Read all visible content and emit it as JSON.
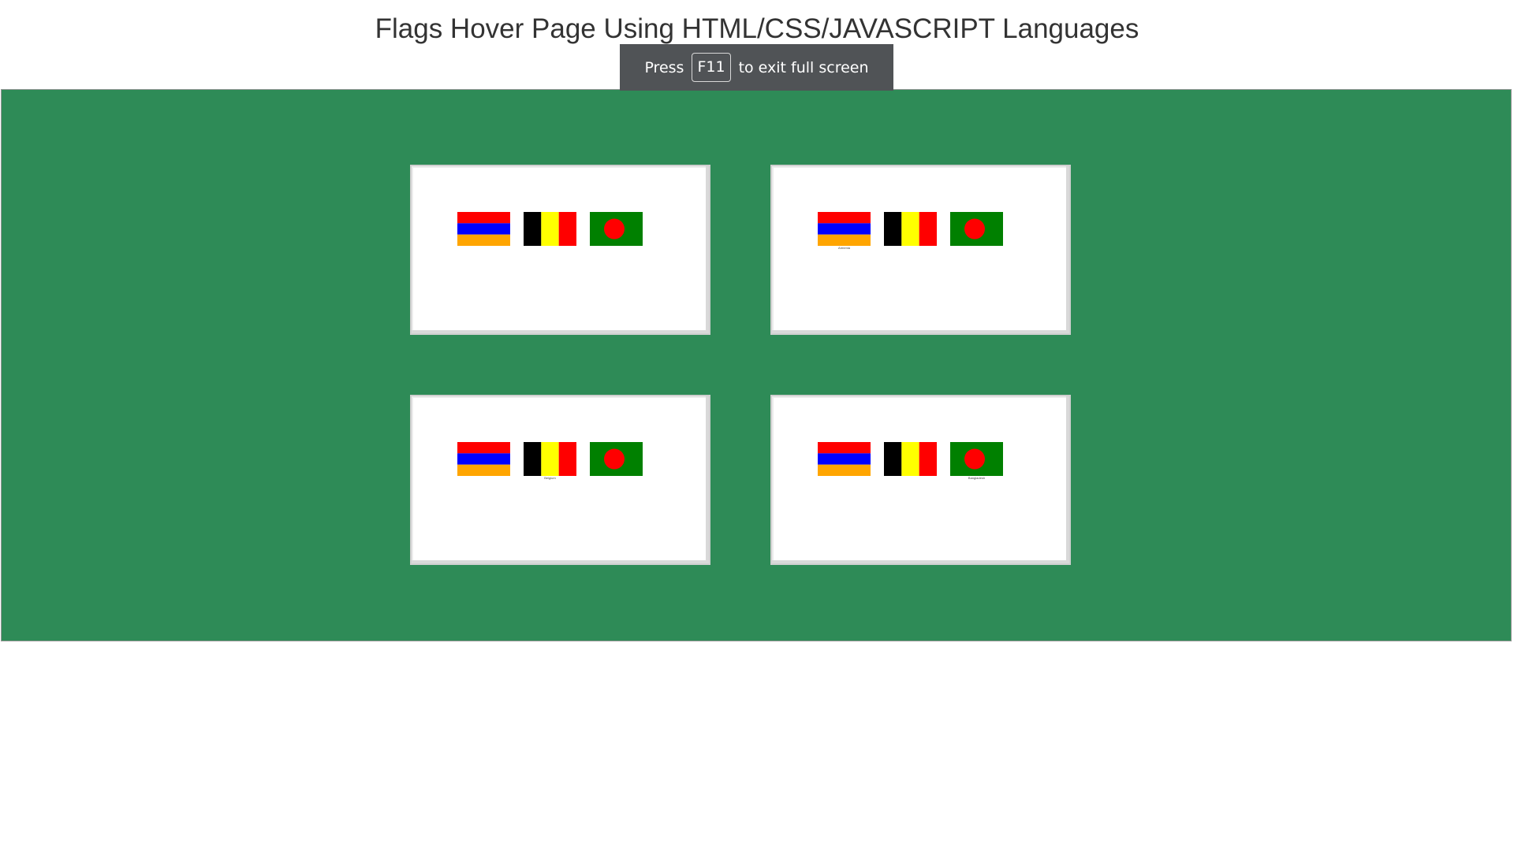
{
  "header": {
    "title": "Flags Hover Page Using HTML/CSS/JAVASCRIPT Languages"
  },
  "fullscreen_toast": {
    "prefix": "Press",
    "key": "F11",
    "suffix": "to exit full screen"
  },
  "colors": {
    "stage_background": "#2e8b57",
    "card_background": "#ffffff",
    "armenia": [
      "#ff0000",
      "#0000ff",
      "#ffa500"
    ],
    "belgium": [
      "#000000",
      "#ffff00",
      "#ff0000"
    ],
    "bangladesh": [
      "#008000",
      "#ff0000"
    ]
  },
  "cards": [
    {
      "flags": [
        "armenia-flag",
        "belgium-flag",
        "bangladesh-flag"
      ],
      "captions": [
        "",
        "",
        ""
      ]
    },
    {
      "flags": [
        "armenia-flag",
        "belgium-flag",
        "bangladesh-flag"
      ],
      "captions": [
        "Armenia",
        "",
        ""
      ]
    },
    {
      "flags": [
        "armenia-flag",
        "belgium-flag",
        "bangladesh-flag"
      ],
      "captions": [
        "",
        "Belgium",
        ""
      ]
    },
    {
      "flags": [
        "armenia-flag",
        "belgium-flag",
        "bangladesh-flag"
      ],
      "captions": [
        "",
        "",
        "Bangladesh"
      ]
    }
  ]
}
